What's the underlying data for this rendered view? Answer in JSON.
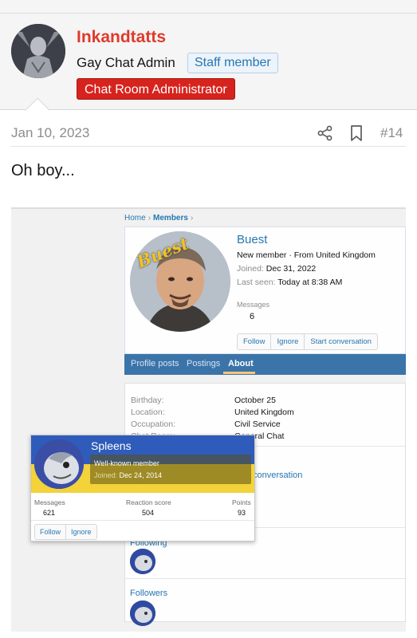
{
  "author": {
    "name": "Inkandtatts",
    "title": "Gay Chat Admin",
    "staff_badge": "Staff member",
    "banner": "Chat Room Administrator"
  },
  "post": {
    "date": "Jan 10, 2023",
    "number": "#14",
    "body": "Oh boy..."
  },
  "embedded": {
    "breadcrumb": {
      "home": "Home",
      "members": "Members"
    },
    "profile": {
      "name": "Buest",
      "avatar_caption": "Buest",
      "subtitle": "New member · From United Kingdom",
      "joined_label": "Joined:",
      "joined_value": "Dec 31, 2022",
      "seen_label": "Last seen:",
      "seen_value": "Today at 8:38 AM",
      "messages_label": "Messages",
      "messages_value": "6",
      "buttons": [
        "Follow",
        "Ignore",
        "Start conversation"
      ]
    },
    "tabs": [
      "Profile posts",
      "Postings",
      "About"
    ],
    "active_tab": "About",
    "about": {
      "rows": [
        {
          "label": "Birthday:",
          "value": "October 25"
        },
        {
          "label": "Location:",
          "value": "United Kingdom"
        },
        {
          "label": "Occupation:",
          "value": "Civil Service"
        },
        {
          "label": "Chat Room:",
          "value": "General Chat"
        }
      ],
      "conversation_link": "conversation",
      "following_link": "Following",
      "followers_link": "Followers"
    },
    "tooltip": {
      "name": "Spleens",
      "role": "Well-known member",
      "joined_label": "Joined:",
      "joined_value": "Dec 24, 2014",
      "stats": [
        {
          "label": "Messages",
          "value": "621"
        },
        {
          "label": "Reaction score",
          "value": "504"
        },
        {
          "label": "Points",
          "value": "93"
        }
      ],
      "buttons": [
        "Follow",
        "Ignore"
      ]
    }
  },
  "colors": {
    "accent": "#2577b1",
    "author_name": "#e03a2a",
    "banner_bg": "#d7231d",
    "tab_bar": "#3b74a9"
  },
  "icons": [
    "share-icon",
    "bookmark-icon"
  ]
}
